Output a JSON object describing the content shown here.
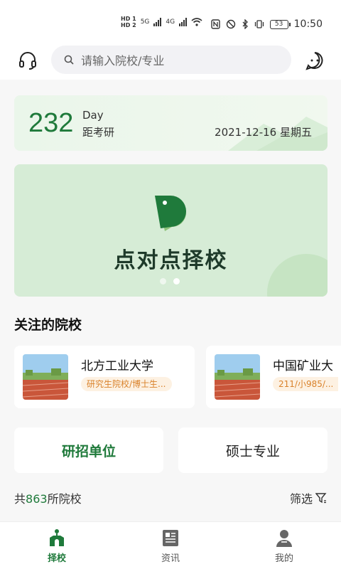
{
  "status_bar": {
    "hd1": "HD 1",
    "hd2": "HD 2",
    "net1": "5G",
    "net2": "4G",
    "battery": "53",
    "time": "10:50"
  },
  "header": {
    "search_placeholder": "请输入院校/专业"
  },
  "countdown": {
    "days": "232",
    "unit": "Day",
    "label": "距考研",
    "date": "2021-12-16 星期五"
  },
  "banner": {
    "title": "点对点择校",
    "slides": 2,
    "active_slide": 2
  },
  "followed": {
    "title": "关注的院校",
    "schools": [
      {
        "name": "北方工业大学",
        "tag": "研究生院校/博士生..."
      },
      {
        "name": "中国矿业大",
        "tag": "211/小985/..."
      }
    ]
  },
  "tabs": [
    {
      "label": "研招单位",
      "active": true
    },
    {
      "label": "硕士专业",
      "active": false
    }
  ],
  "count": {
    "prefix": "共",
    "number": "863",
    "suffix": "所院校",
    "filter_label": "筛选"
  },
  "bottom_nav": [
    {
      "label": "择校",
      "icon": "school-icon",
      "active": true
    },
    {
      "label": "资讯",
      "icon": "news-icon",
      "active": false
    },
    {
      "label": "我的",
      "icon": "profile-icon",
      "active": false
    }
  ],
  "colors": {
    "brand_green": "#1f7a3b",
    "tag_orange": "#d9822b",
    "tag_bg": "#fdf1e2"
  }
}
